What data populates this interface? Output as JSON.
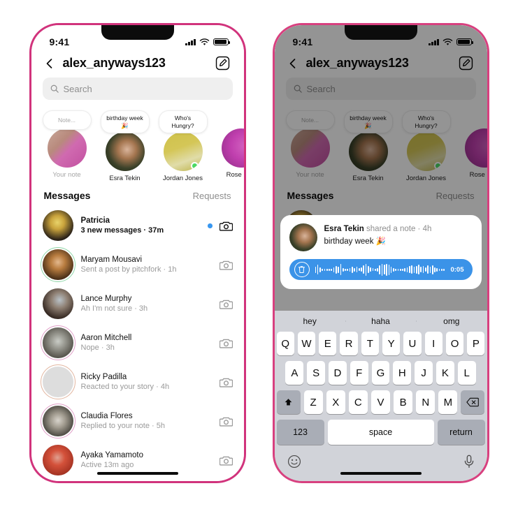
{
  "status_bar": {
    "time": "9:41",
    "signal_icon": "cellular-bars-icon",
    "wifi_icon": "wifi-icon",
    "battery_icon": "battery-full-icon"
  },
  "header": {
    "back_icon": "back-chevron-icon",
    "username": "alex_anyways123",
    "compose_icon": "compose-new-message-icon"
  },
  "search": {
    "icon": "search-icon",
    "placeholder": "Search",
    "value": ""
  },
  "notes": [
    {
      "bubble": "Note...",
      "name": "Your note",
      "muted": true,
      "online": false,
      "avatar": "note-avatar-self"
    },
    {
      "bubble": "birthday week 🎉",
      "name": "Esra Tekin",
      "muted": false,
      "online": false,
      "avatar": "note-avatar-esra"
    },
    {
      "bubble": "Who's Hungry?",
      "name": "Jordan Jones",
      "muted": false,
      "online": true,
      "avatar": "note-avatar-jordan"
    },
    {
      "bubble": "",
      "name": "Rose Pad",
      "muted": false,
      "online": false,
      "avatar": "note-avatar-rose"
    }
  ],
  "section": {
    "title": "Messages",
    "action": "Requests"
  },
  "messages": [
    {
      "name": "Patricia",
      "preview": "3 new messages · 37m",
      "unread": true,
      "dot": true,
      "ring": "none",
      "camera_icon": "camera-icon"
    },
    {
      "name": "Maryam Mousavi",
      "preview": "Sent a post by pitchfork · 1h",
      "unread": false,
      "dot": false,
      "ring": "green",
      "camera_icon": "camera-icon"
    },
    {
      "name": "Lance Murphy",
      "preview": "Ah I'm not sure · 3h",
      "unread": false,
      "dot": false,
      "ring": "none",
      "camera_icon": "camera-icon"
    },
    {
      "name": "Aaron Mitchell",
      "preview": "Nope · 3h",
      "unread": false,
      "dot": false,
      "ring": "story",
      "camera_icon": "camera-icon"
    },
    {
      "name": "Ricky Padilla",
      "preview": "Reacted to your story · 4h",
      "unread": false,
      "dot": false,
      "ring": "story",
      "camera_icon": "camera-icon"
    },
    {
      "name": "Claudia Flores",
      "preview": "Replied to your note · 5h",
      "unread": false,
      "dot": false,
      "ring": "story",
      "camera_icon": "camera-icon"
    },
    {
      "name": "Ayaka Yamamoto",
      "preview": "Active 13m ago",
      "unread": false,
      "dot": false,
      "ring": "none",
      "camera_icon": "camera-icon"
    }
  ],
  "note_reply_card": {
    "author": "Esra Tekin",
    "action": " shared a note · 4h",
    "note_text": "birthday week 🎉",
    "avatar": "note-card-avatar-esra",
    "voice": {
      "delete_icon": "trash-icon",
      "duration": "0:05",
      "waveform_icon": "audio-waveform",
      "bar_color": "#3b93e8"
    }
  },
  "keyboard": {
    "suggestions": [
      "hey",
      "haha",
      "omg"
    ],
    "row1": [
      "Q",
      "W",
      "E",
      "R",
      "T",
      "Y",
      "U",
      "I",
      "O",
      "P"
    ],
    "row2": [
      "A",
      "S",
      "D",
      "F",
      "G",
      "H",
      "J",
      "K",
      "L"
    ],
    "row3_letters": [
      "Z",
      "X",
      "C",
      "V",
      "B",
      "N",
      "M"
    ],
    "shift_icon": "shift-arrow-icon",
    "backspace_icon": "backspace-delete-icon",
    "numbers_key": "123",
    "space_key": "space",
    "return_key": "return",
    "emoji_icon": "emoji-smiley-icon",
    "dictation_icon": "microphone-icon"
  },
  "theme": {
    "frame_pink": "#d1337c",
    "accent_blue": "#3897f0",
    "online_green": "#4cd964",
    "muted_gray": "#8e8e8e"
  }
}
